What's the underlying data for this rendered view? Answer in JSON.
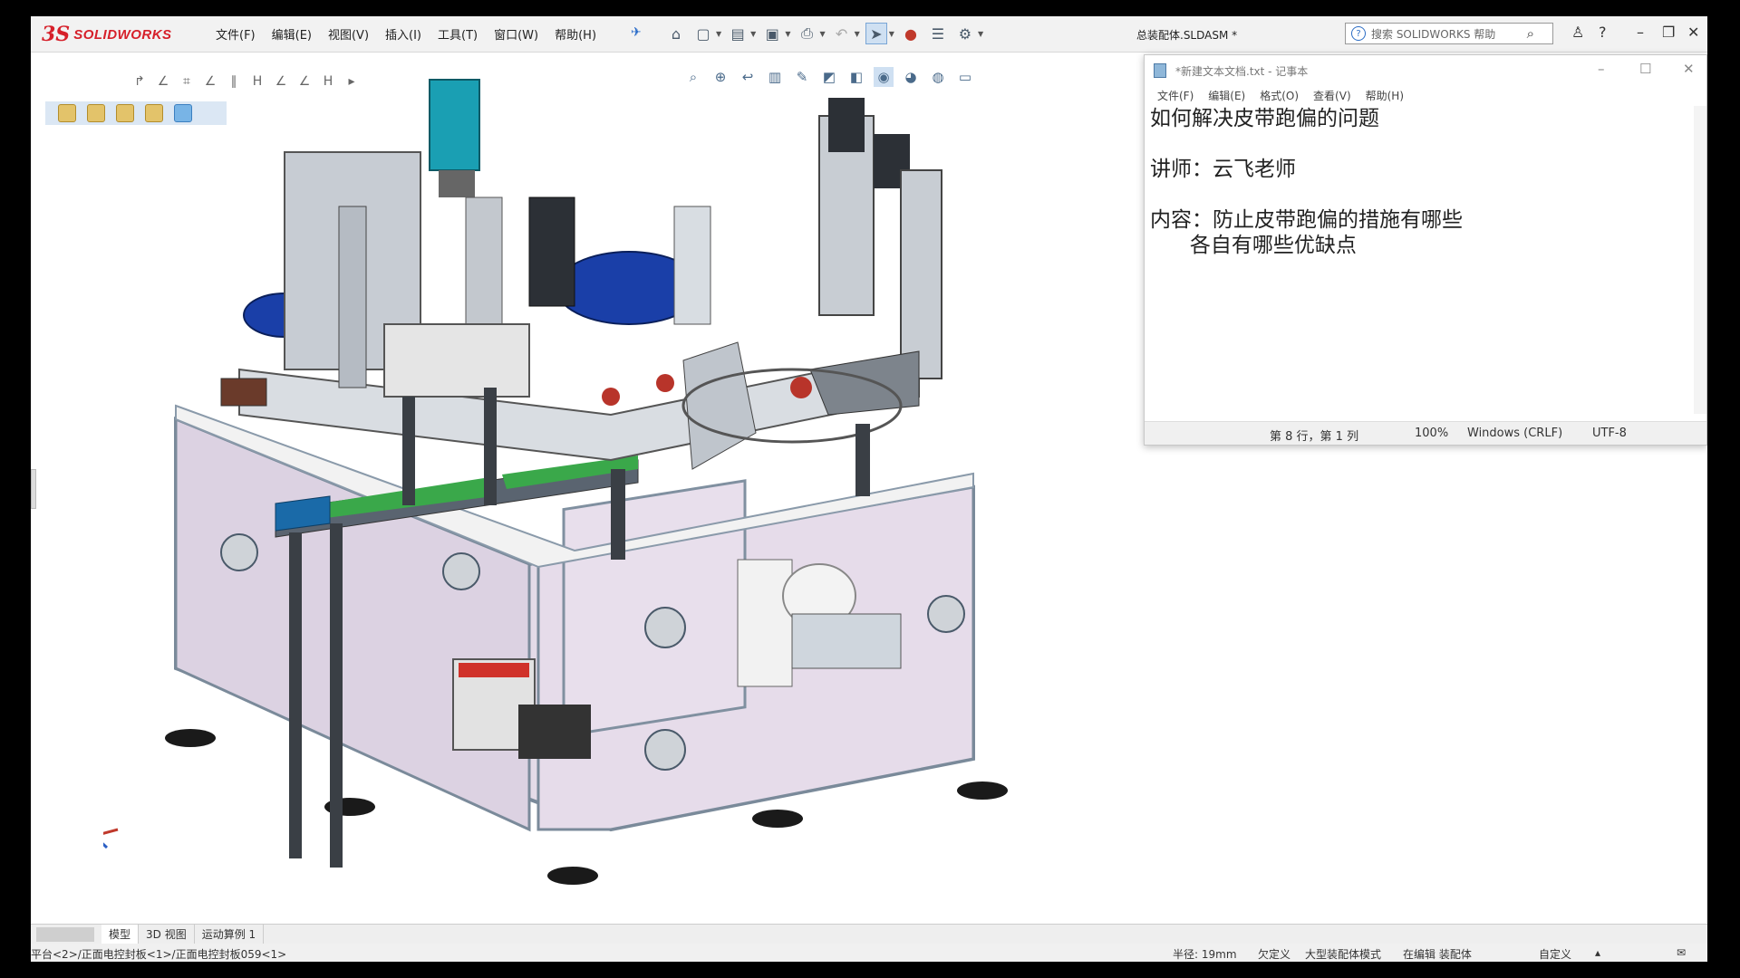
{
  "app": {
    "logo_ds": "3S",
    "logo_text": "SOLIDWORKS",
    "document_title": "总装配体.SLDASM *"
  },
  "menu": [
    "文件(F)",
    "编辑(E)",
    "视图(V)",
    "插入(I)",
    "工具(T)",
    "窗口(W)",
    "帮助(H)"
  ],
  "search": {
    "placeholder": "搜索 SOLIDWORKS 帮助"
  },
  "notepad": {
    "title": "*新建文本文档.txt - 记事本",
    "menu": [
      "文件(F)",
      "编辑(E)",
      "格式(O)",
      "查看(V)",
      "帮助(H)"
    ],
    "lines": [
      "如何解决皮带跑偏的问题",
      "",
      "讲师：云飞老师",
      "",
      "内容：防止皮带跑偏的措施有哪些",
      "      各自有哪些优缺点"
    ],
    "status": {
      "position": "第 8 行，第 1 列",
      "zoom": "100%",
      "eol": "Windows (CRLF)",
      "encoding": "UTF-8"
    }
  },
  "tabs": [
    "模型",
    "3D 视图",
    "运动算例 1"
  ],
  "status_bar": {
    "path": "平台<2>/正面电控封板<1>/正面电控封板059<1>",
    "radius": "半径: 19mm",
    "definition": "欠定义",
    "mode": "大型装配体模式",
    "editing": "在编辑 装配体",
    "custom": "自定义"
  },
  "colors": {
    "frame": "#e8e0ea",
    "frame_dark": "#7a8a9a",
    "accent_blue": "#1a6aa8",
    "conveyor_green": "#3aa84a",
    "motor_cyan": "#1a9fb3",
    "logo_red": "#d6202a"
  }
}
